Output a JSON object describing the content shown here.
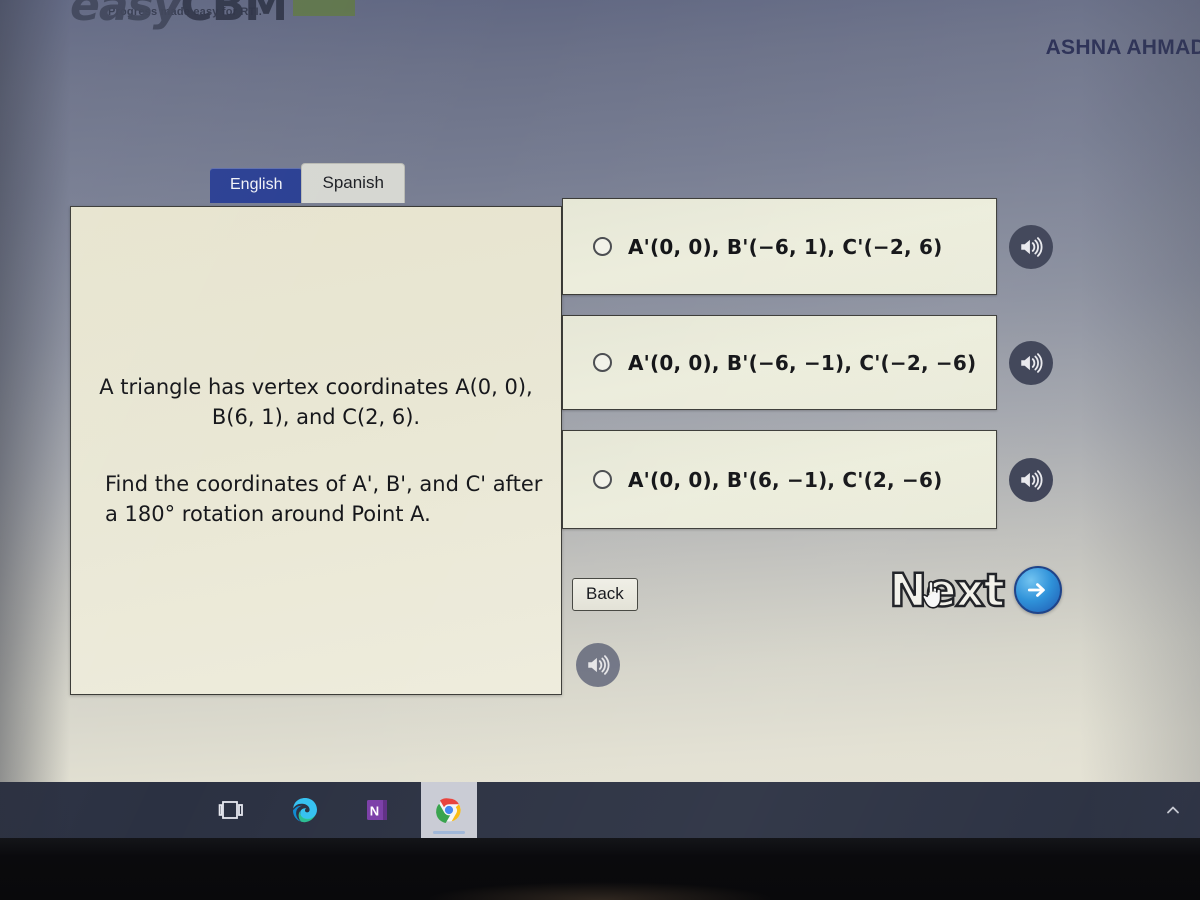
{
  "brand": {
    "name_light": "easy",
    "name_bold": "CBM",
    "tagline": "Progress made easy for RTI."
  },
  "header": {
    "user_name": "ASHNA AHMAD"
  },
  "language_tabs": [
    {
      "label": "English",
      "active": true
    },
    {
      "label": "Spanish",
      "active": false
    }
  ],
  "question": {
    "paragraph_1": "A triangle has vertex coordinates A(0, 0), B(6, 1), and C(2, 6).",
    "paragraph_2": "Find the coordinates of A', B', and C' after a 180° rotation around Point A."
  },
  "answers": [
    {
      "text": "A'(0, 0), B'(−6, 1), C'(−2, 6)",
      "selected": false,
      "audio_icon": "speaker-icon"
    },
    {
      "text": "A'(0, 0), B'(−6, −1), C'(−2, −6)",
      "selected": false,
      "audio_icon": "speaker-icon"
    },
    {
      "text": "A'(0, 0), B'(6, −1), C'(2, −6)",
      "selected": false,
      "audio_icon": "speaker-icon"
    }
  ],
  "footer": {
    "back_label": "Back",
    "next_label": "Next",
    "next_icon": "arrow-right-circle-icon",
    "question_audio_icon": "speaker-icon"
  },
  "taskbar": {
    "items": [
      {
        "name": "task-view",
        "label": "Task View",
        "running": false,
        "active": false
      },
      {
        "name": "microsoft-edge",
        "label": "Microsoft Edge",
        "running": true,
        "active": false
      },
      {
        "name": "onenote",
        "label": "OneNote",
        "running": false,
        "active": false
      },
      {
        "name": "google-chrome",
        "label": "Google Chrome",
        "running": true,
        "active": true
      }
    ],
    "tray": [
      {
        "name": "show-hidden-icons",
        "label": "Show hidden icons"
      }
    ]
  },
  "colors": {
    "tab_active": "#2a3f93",
    "panel_bg": "#e9e7d4",
    "next_arrow": "#2a8fd8",
    "taskbar": "#2b3142",
    "user_name": "#262b52"
  }
}
